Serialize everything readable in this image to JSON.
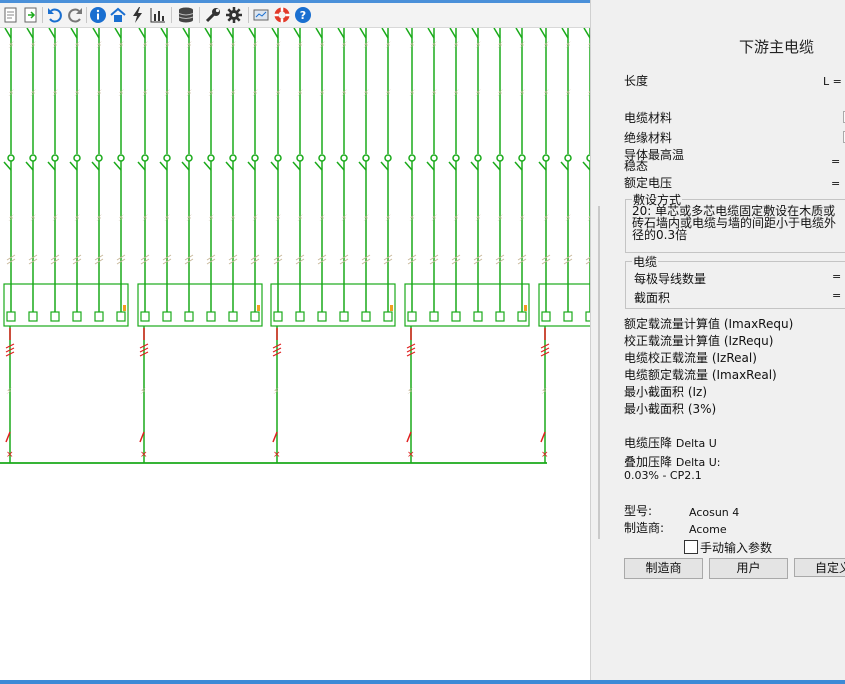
{
  "toolbar": {
    "icons": [
      "page-icon",
      "import-icon",
      "undo-icon",
      "redo-icon",
      "info-icon",
      "home-icon",
      "lightning-icon",
      "bar-chart-icon",
      "database-icon",
      "wrench-icon",
      "gear-icon",
      "screen-icon",
      "lifebuoy-icon",
      "help-icon"
    ],
    "colors": {
      "info": "#1a6fd0",
      "help": "#1a6fd0",
      "lifebuoy": "#e23a2a",
      "dark": "#333333"
    }
  },
  "diagram": {
    "colors": {
      "wire": "#1aaa1a",
      "breaker_mark": "#e02020",
      "surge_mark": "#c8b89a",
      "accent": "#f0a020"
    },
    "groups": 5,
    "feeders_per_group": 6
  },
  "panel": {
    "title": "下游主电缆",
    "length": {
      "label": "长度",
      "value": "L ="
    },
    "cable_material": {
      "label": "电缆材料"
    },
    "insulation_material": {
      "label": "绝缘材料"
    },
    "conductor_max_temp": {
      "label": "导体最高温"
    },
    "steady_state": {
      "label": "稳态",
      "value": "="
    },
    "rated_voltage": {
      "label": "额定电压",
      "value": "="
    },
    "installation": {
      "legend": "敷设方式",
      "text": "20: 单芯或多芯电缆固定敷设在木质或砖石墙内或电缆与墙的间距小于电缆外径的0.3倍"
    },
    "cable_frame": {
      "legend": "电缆",
      "conductors_per_phase": {
        "label": "每极导线数量",
        "value": "="
      },
      "cross_section": {
        "label": "截面积",
        "value": "="
      }
    },
    "results": [
      "额定载流量计算值 (ImaxRequ)",
      "校正载流量计算值 (IzRequ)",
      "电缆校正载流量 (IzReal)",
      "电缆额定载流量 (ImaxReal)",
      "最小截面积  (Iz)",
      "最小截面积  (3%)"
    ],
    "voltage_drop": {
      "label": "电缆压降",
      "value": "Delta U"
    },
    "added_drop": {
      "label": "叠加压降",
      "value": "Delta U:",
      "detail": "0.03% - CP2.1"
    },
    "model": {
      "label": "型号:",
      "value": "Acosun 4"
    },
    "manufacturer": {
      "label": "制造商:",
      "value": "Acome"
    },
    "manual_input": {
      "label": "手动输入参数",
      "checked": false
    },
    "buttons": {
      "manufacturer": "制造商",
      "user": "用户",
      "custom": "自定义"
    }
  }
}
